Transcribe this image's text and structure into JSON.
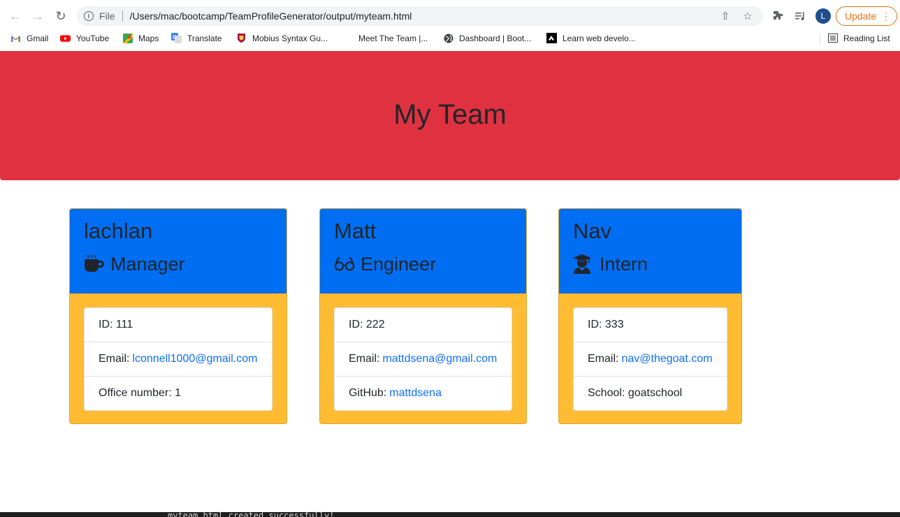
{
  "browser": {
    "scheme_label": "File",
    "url": "/Users/mac/bootcamp/TeamProfileGenerator/output/myteam.html",
    "profile_initial": "L",
    "update_label": "Update",
    "bookmarks": [
      {
        "label": "Gmail",
        "icon": "gmail-icon"
      },
      {
        "label": "YouTube",
        "icon": "youtube-icon"
      },
      {
        "label": "Maps",
        "icon": "maps-icon"
      },
      {
        "label": "Translate",
        "icon": "translate-icon"
      },
      {
        "label": "Mobius Syntax Gu...",
        "icon": "mobius-icon"
      },
      {
        "label": "Meet The Team |...",
        "icon": ""
      },
      {
        "label": "Dashboard | Boot...",
        "icon": "globe-icon"
      },
      {
        "label": "Learn web develo...",
        "icon": "mdn-icon"
      }
    ],
    "reading_list_label": "Reading List"
  },
  "page": {
    "title": "My Team",
    "header_color": "#e03140",
    "card_header_color": "#006ef2",
    "card_body_color": "#ffbc33",
    "link_color": "#0d6efd"
  },
  "team": [
    {
      "name": "lachlan",
      "role": "Manager",
      "role_icon": "mug-icon",
      "id_text": "ID: 111",
      "email_prefix": "Email:",
      "email": "lconnell1000@gmail.com",
      "extra_prefix": "Office number: 1",
      "extra_link": ""
    },
    {
      "name": "Matt",
      "role": "Engineer",
      "role_icon": "glasses-icon",
      "id_text": "ID: 222",
      "email_prefix": "Email:",
      "email": "mattdsena@gmail.com",
      "extra_prefix": "GitHub:",
      "extra_link": "mattdsena"
    },
    {
      "name": "Nav",
      "role": "Intern",
      "role_icon": "graduate-icon",
      "id_text": "ID: 333",
      "email_prefix": "Email:",
      "email": "nav@thegoat.com",
      "extra_prefix": "School: goatschool",
      "extra_link": ""
    }
  ],
  "terminal": {
    "text": "myteam.html created successfully!"
  }
}
